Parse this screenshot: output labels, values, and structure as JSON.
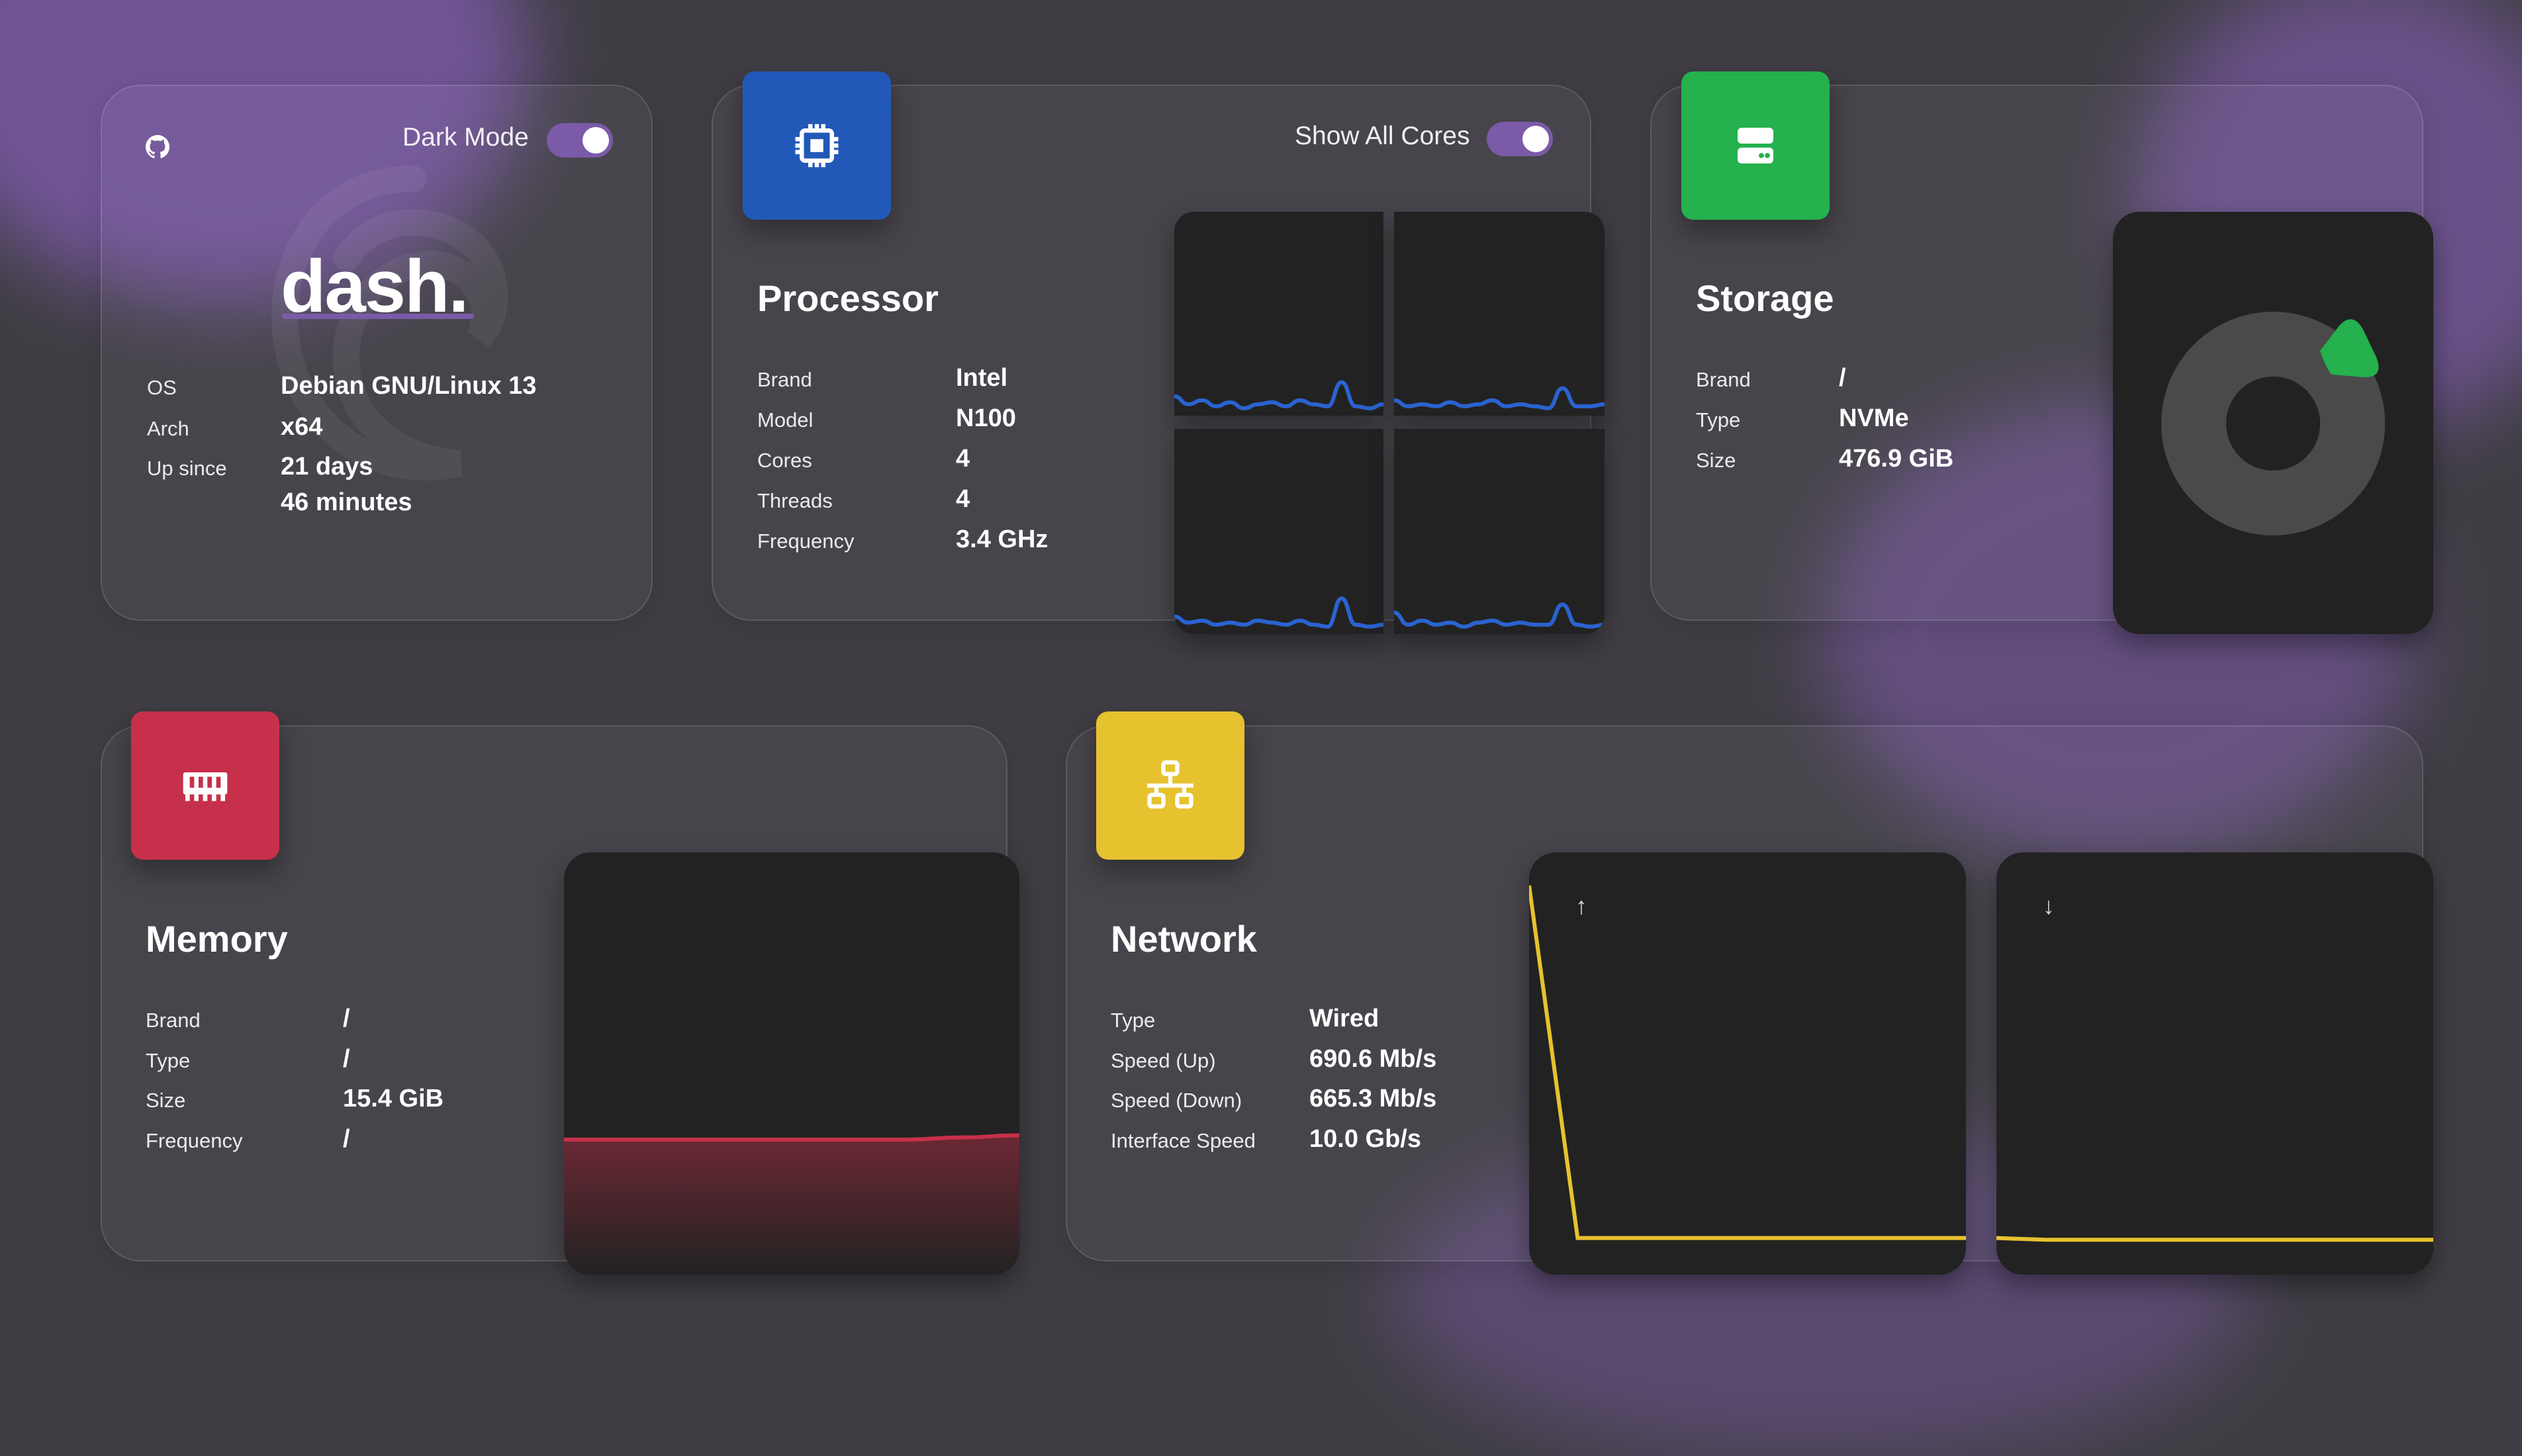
{
  "colors": {
    "background": "#403e44",
    "accent_purple": "#7b5aa8",
    "processor": "#2259b8",
    "storage": "#24b14e",
    "memory": "#c7304a",
    "network": "#e6c22f",
    "panel": "#222222"
  },
  "system": {
    "github_icon": "github-icon",
    "dark_mode_label": "Dark Mode",
    "dark_mode_on": true,
    "logo_text": "dash.",
    "rows": [
      {
        "label": "OS",
        "value": "Debian GNU/Linux 13"
      },
      {
        "label": "Arch",
        "value": "x64"
      },
      {
        "label": "Up since",
        "value": "21 days",
        "value2": "46 minutes"
      }
    ]
  },
  "processor": {
    "icon": "cpu-icon",
    "title": "Processor",
    "show_all_cores_label": "Show All Cores",
    "show_all_cores_on": true,
    "rows": [
      {
        "label": "Brand",
        "value": "Intel"
      },
      {
        "label": "Model",
        "value": "N100"
      },
      {
        "label": "Cores",
        "value": "4"
      },
      {
        "label": "Threads",
        "value": "4"
      },
      {
        "label": "Frequency",
        "value": "3.4 GHz"
      }
    ]
  },
  "storage": {
    "icon": "hard-drive-icon",
    "title": "Storage",
    "rows": [
      {
        "label": "Brand",
        "value": "/"
      },
      {
        "label": "Type",
        "value": "NVMe"
      },
      {
        "label": "Size",
        "value": "476.9 GiB"
      }
    ],
    "used_fraction": 0.1
  },
  "memory": {
    "icon": "ram-icon",
    "title": "Memory",
    "rows": [
      {
        "label": "Brand",
        "value": "/"
      },
      {
        "label": "Type",
        "value": "/"
      },
      {
        "label": "Size",
        "value": "15.4 GiB"
      },
      {
        "label": "Frequency",
        "value": "/"
      }
    ]
  },
  "network": {
    "icon": "network-icon",
    "title": "Network",
    "rows": [
      {
        "label": "Type",
        "value": "Wired"
      },
      {
        "label": "Speed (Up)",
        "value": "690.6 Mb/s"
      },
      {
        "label": "Speed (Down)",
        "value": "665.3 Mb/s"
      },
      {
        "label": "Interface Speed",
        "value": "10.0 Gb/s"
      }
    ],
    "up_arrow": "↑",
    "down_arrow": "↓"
  },
  "chart_data": [
    {
      "type": "line",
      "name": "cpu-core-1",
      "values": [
        8,
        4,
        6,
        3,
        5,
        2,
        4,
        5,
        3,
        6,
        4,
        3,
        15,
        3,
        2,
        4
      ]
    },
    {
      "type": "line",
      "name": "cpu-core-2",
      "values": [
        6,
        3,
        4,
        3,
        5,
        3,
        4,
        6,
        3,
        4,
        3,
        2,
        12,
        3,
        3,
        4
      ]
    },
    {
      "type": "line",
      "name": "cpu-core-3",
      "values": [
        7,
        4,
        5,
        3,
        4,
        3,
        5,
        4,
        3,
        5,
        3,
        2,
        16,
        3,
        2,
        3
      ]
    },
    {
      "type": "line",
      "name": "cpu-core-4",
      "values": [
        9,
        3,
        5,
        3,
        4,
        2,
        4,
        5,
        3,
        4,
        3,
        3,
        13,
        3,
        2,
        3
      ]
    },
    {
      "type": "area",
      "name": "memory",
      "values": [
        32,
        32,
        32,
        32,
        32,
        32,
        32,
        32.5,
        33
      ]
    },
    {
      "type": "line",
      "name": "network-up",
      "values": [
        100,
        1,
        1,
        1,
        1,
        1,
        1,
        1,
        1,
        1
      ]
    },
    {
      "type": "line",
      "name": "network-down",
      "values": [
        1,
        0.5,
        0.5,
        0.5,
        0.5,
        0.5,
        0.5,
        0.5,
        0.5,
        0.5
      ]
    }
  ]
}
